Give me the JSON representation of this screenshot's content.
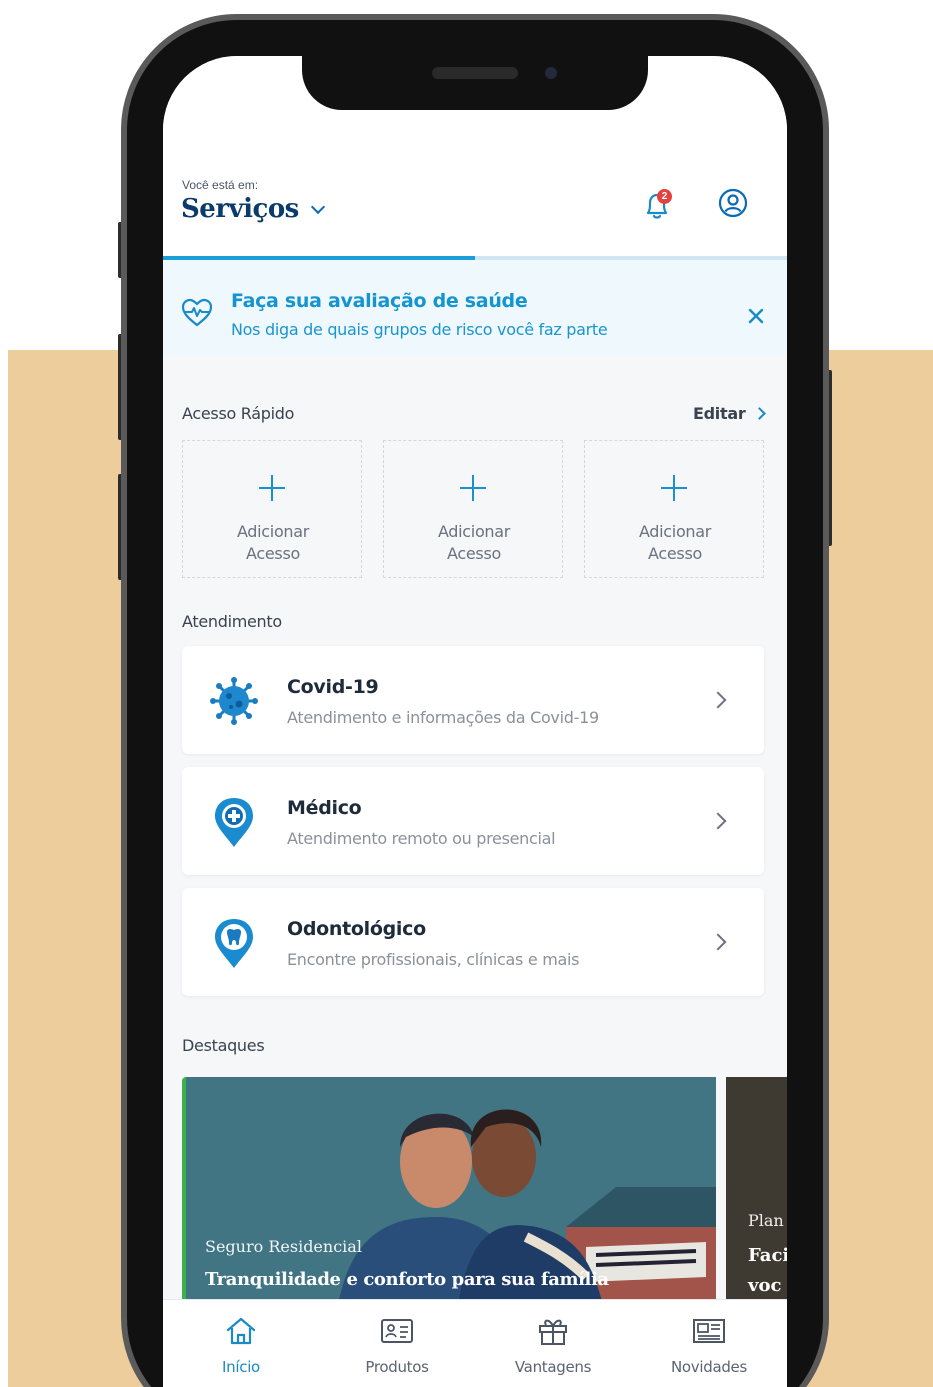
{
  "header": {
    "location_caption": "Você está em:",
    "section_title": "Serviços",
    "notification_count": "2"
  },
  "health_banner": {
    "title": "Faça sua avaliação de saúde",
    "subtitle": "Nos diga de quais grupos de risco você faz parte"
  },
  "quick_access": {
    "heading": "Acesso Rápido",
    "edit_label": "Editar",
    "tiles": [
      {
        "line1": "Adicionar",
        "line2": "Acesso"
      },
      {
        "line1": "Adicionar",
        "line2": "Acesso"
      },
      {
        "line1": "Adicionar",
        "line2": "Acesso"
      }
    ]
  },
  "service": {
    "heading": "Atendimento",
    "cards": [
      {
        "icon": "virus-icon",
        "title": "Covid-19",
        "subtitle": "Atendimento e informações da Covid-19"
      },
      {
        "icon": "medical-pin-icon",
        "title": "Médico",
        "subtitle": "Atendimento remoto ou presencial"
      },
      {
        "icon": "tooth-pin-icon",
        "title": "Odontológico",
        "subtitle": "Encontre profissionais, clínicas e mais"
      }
    ]
  },
  "highlights": {
    "heading": "Destaques",
    "items": [
      {
        "kicker": "Seguro Residencial",
        "title": "Tranquilidade e conforto para sua família"
      },
      {
        "kicker": "Plan",
        "title_line1": "Faci",
        "title_line2": "voc"
      }
    ]
  },
  "tabbar": {
    "tabs": [
      {
        "label": "Início",
        "icon": "home-icon",
        "active": true
      },
      {
        "label": "Produtos",
        "icon": "id-card-icon",
        "active": false
      },
      {
        "label": "Vantagens",
        "icon": "gift-icon",
        "active": false
      },
      {
        "label": "Novidades",
        "icon": "newspaper-icon",
        "active": false
      }
    ]
  },
  "colors": {
    "brand_blue": "#0a3b6b",
    "accent_blue": "#1a90cf",
    "background_band": "#eecd9c",
    "alert_red": "#e3423f",
    "highlight_green": "#3bb34a"
  }
}
